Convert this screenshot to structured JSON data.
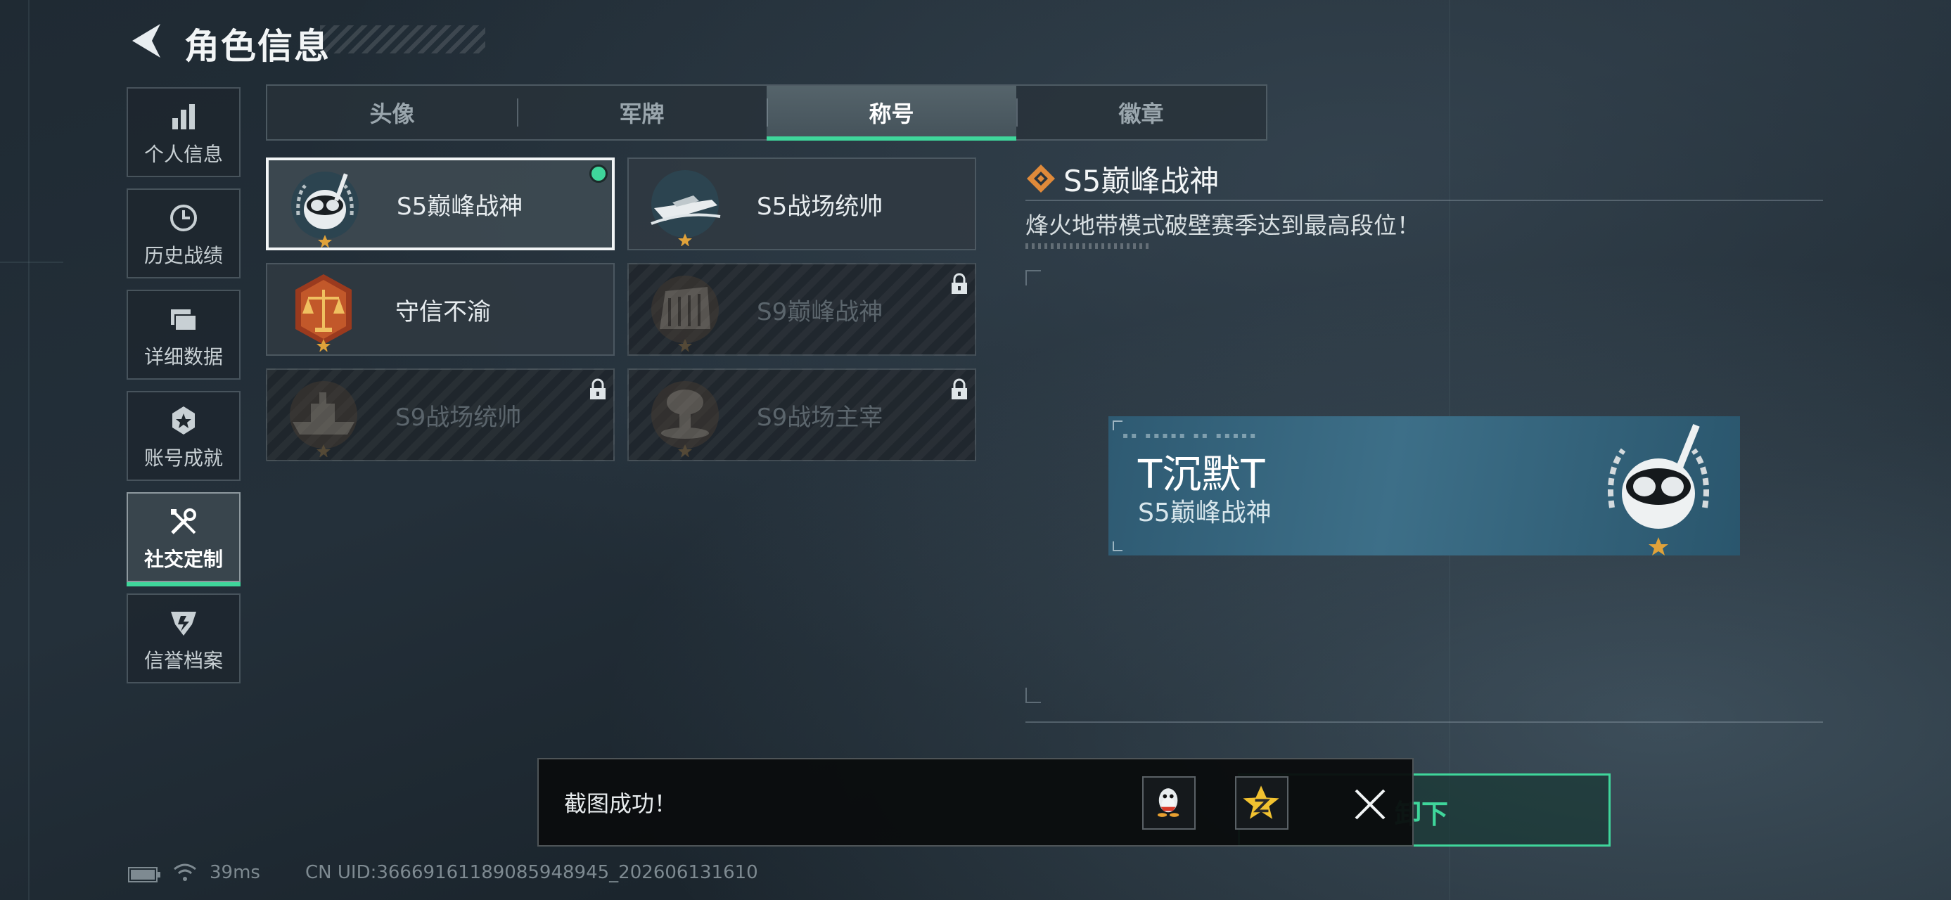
{
  "header": {
    "title": "角色信息"
  },
  "sidebar": {
    "items": [
      {
        "label": "个人信息",
        "icon": "bar-chart-icon"
      },
      {
        "label": "历史战绩",
        "icon": "clock-icon"
      },
      {
        "label": "详细数据",
        "icon": "folder-icon"
      },
      {
        "label": "账号成就",
        "icon": "medal-icon"
      },
      {
        "label": "社交定制",
        "icon": "tools-icon",
        "active": true
      },
      {
        "label": "信誉档案",
        "icon": "shield-icon"
      }
    ]
  },
  "tabs": [
    {
      "label": "头像"
    },
    {
      "label": "军牌"
    },
    {
      "label": "称号",
      "active": true
    },
    {
      "label": "徽章"
    }
  ],
  "titles": [
    {
      "name": "S5巅峰战神",
      "emblem": "skull-diver-emblem",
      "selected": true,
      "equipped": true,
      "locked": false
    },
    {
      "name": "S5战场统帅",
      "emblem": "speedboat-emblem",
      "locked": false
    },
    {
      "name": "守信不渝",
      "emblem": "scales-emblem",
      "locked": false
    },
    {
      "name": "S9巅峰战神",
      "emblem": "fortress-emblem",
      "locked": true
    },
    {
      "name": "S9战场统帅",
      "emblem": "warship-emblem",
      "locked": true
    },
    {
      "name": "S9战场主宰",
      "emblem": "mushroom-cloud-emblem",
      "locked": true
    }
  ],
  "detail": {
    "title": "S5巅峰战神",
    "description": "烽火地带模式破壁赛季达到最高段位！"
  },
  "preview": {
    "player_name": "T沉默T",
    "title": "S5巅峰战神"
  },
  "unequip_button": {
    "label": "卸下"
  },
  "toast": {
    "text": "截图成功！",
    "share": [
      "qq-icon",
      "qzone-icon"
    ]
  },
  "status": {
    "ping": "39ms",
    "uid": "CN UID:3666916118908594894​5_202606131610"
  },
  "colors": {
    "accent": "#3fd69b",
    "detail_icon": "#e08a3a",
    "preview_bg": "#3d6f88"
  }
}
